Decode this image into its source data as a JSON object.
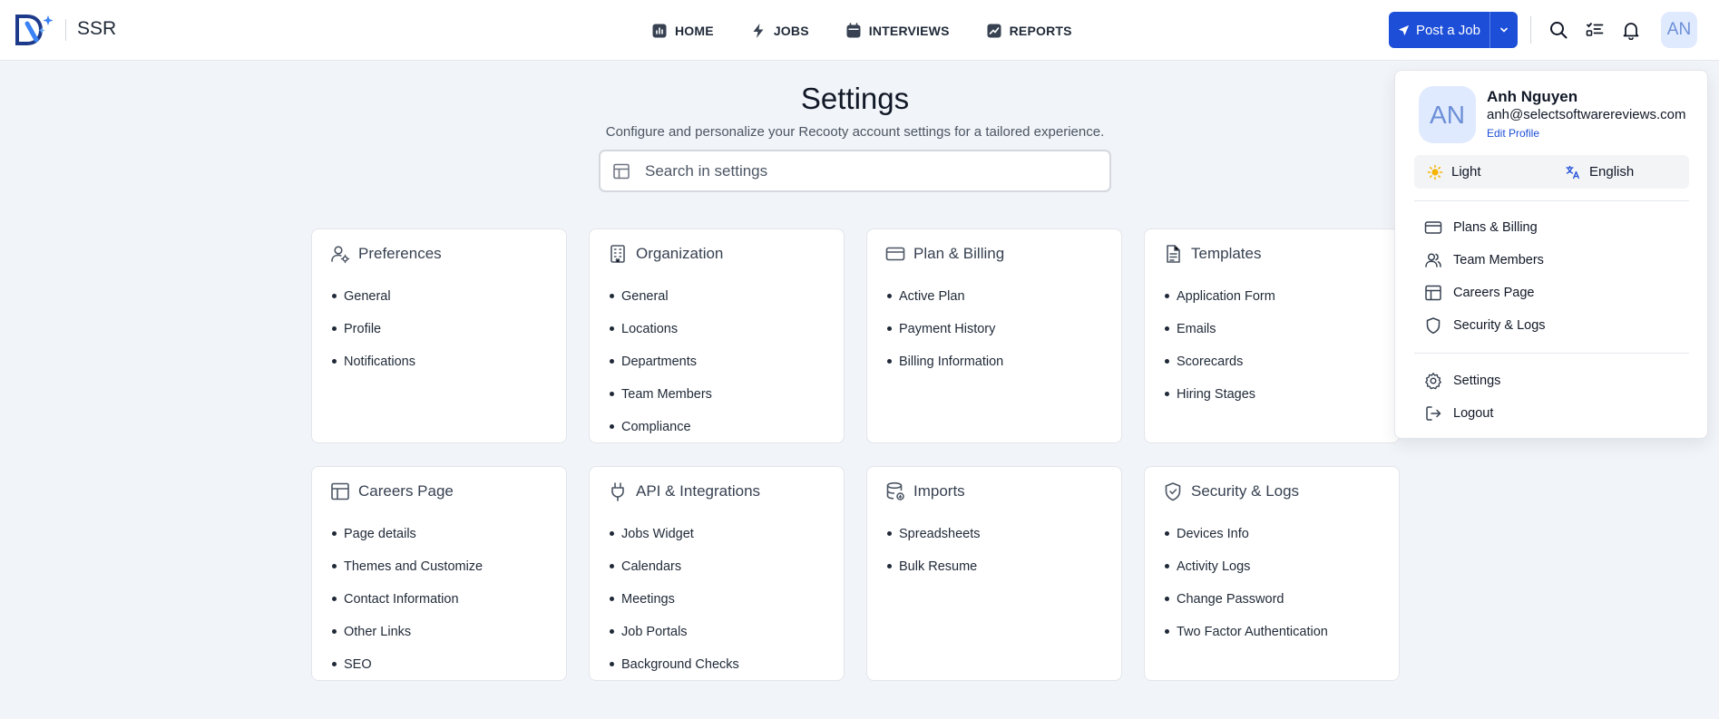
{
  "brand": {
    "name": "SSR"
  },
  "nav": [
    {
      "label": "HOME",
      "icon": "home-chart-icon"
    },
    {
      "label": "JOBS",
      "icon": "bolt-icon"
    },
    {
      "label": "INTERVIEWS",
      "icon": "calendar-icon"
    },
    {
      "label": "REPORTS",
      "icon": "trend-icon"
    }
  ],
  "header": {
    "post_job_label": "Post a Job",
    "avatar_initials": "AN"
  },
  "page": {
    "title": "Settings",
    "subtitle": "Configure and personalize your Recooty account settings for a tailored experience.",
    "search_placeholder": "Search in settings"
  },
  "cards": [
    {
      "title": "Preferences",
      "icon": "user-gear-icon",
      "items": [
        "General",
        "Profile",
        "Notifications"
      ]
    },
    {
      "title": "Organization",
      "icon": "building-icon",
      "items": [
        "General",
        "Locations",
        "Departments",
        "Team Members",
        "Compliance"
      ]
    },
    {
      "title": "Plan & Billing",
      "icon": "credit-card-icon",
      "items": [
        "Active Plan",
        "Payment History",
        "Billing Information"
      ]
    },
    {
      "title": "Templates",
      "icon": "document-icon",
      "items": [
        "Application Form",
        "Emails",
        "Scorecards",
        "Hiring Stages"
      ]
    },
    {
      "title": "Careers Page",
      "icon": "layout-icon",
      "items": [
        "Page details",
        "Themes and Customize",
        "Contact Information",
        "Other Links",
        "SEO"
      ]
    },
    {
      "title": "API & Integrations",
      "icon": "plug-icon",
      "items": [
        "Jobs Widget",
        "Calendars",
        "Meetings",
        "Job Portals",
        "Background Checks"
      ]
    },
    {
      "title": "Imports",
      "icon": "database-import-icon",
      "items": [
        "Spreadsheets",
        "Bulk Resume"
      ]
    },
    {
      "title": "Security & Logs",
      "icon": "shield-icon",
      "items": [
        "Devices Info",
        "Activity Logs",
        "Change Password",
        "Two Factor Authentication"
      ]
    }
  ],
  "profile_menu": {
    "initials": "AN",
    "name": "Anh Nguyen",
    "email": "anh@selectsoftwarereviews.com",
    "edit_label": "Edit Profile",
    "theme_label": "Light",
    "language_label": "English",
    "items": [
      {
        "label": "Plans & Billing",
        "icon": "credit-card-icon"
      },
      {
        "label": "Team Members",
        "icon": "users-icon"
      },
      {
        "label": "Careers Page",
        "icon": "layout-icon"
      },
      {
        "label": "Security & Logs",
        "icon": "shield-icon"
      }
    ],
    "settings_label": "Settings",
    "logout_label": "Logout"
  },
  "colors": {
    "accent": "#1d4ed8",
    "background": "#f1f4f8",
    "avatar_bg": "#e0eaff"
  }
}
